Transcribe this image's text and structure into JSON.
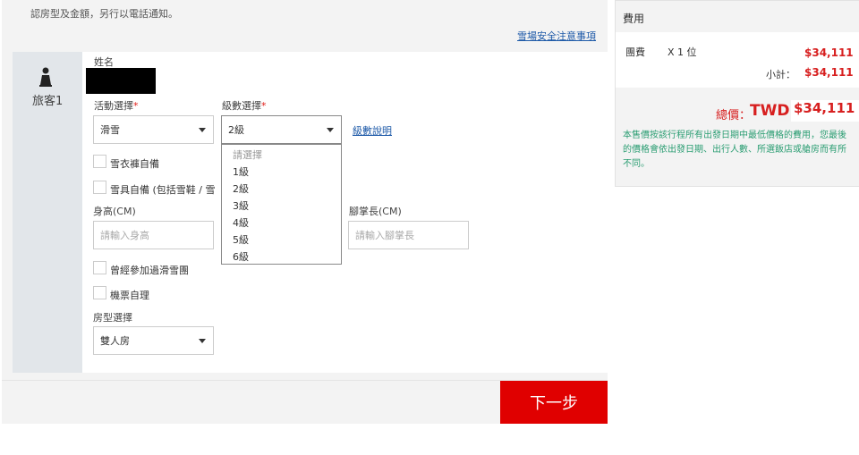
{
  "header": {
    "notice": "認房型及金額，另行以電話通知。",
    "safety_link": "雪場安全注意事項"
  },
  "guest": {
    "label": "旅客1",
    "name_label": "姓名"
  },
  "form": {
    "activity_label": "活動選擇",
    "activity_value": "滑雪",
    "level_label": "級數選擇",
    "level_value": "2級",
    "required_mark": "*",
    "level_help_link": "級數說明",
    "clothes_label": "雪衣褲自備",
    "gear_label": "雪具自備 (包括雪鞋 / 雪",
    "height_label": "身高(CM)",
    "height_placeholder": "請輸入身高",
    "foot_label": "腳掌長(CM)",
    "foot_placeholder": "請輸入腳掌長",
    "joined_label": "曾經參加過滑雪團",
    "flight_label": "機票自理",
    "room_label": "房型選擇",
    "room_value": "雙人房"
  },
  "level_dropdown": {
    "options": [
      "請選擇",
      "1級",
      "2級",
      "3級",
      "4級",
      "5級",
      "6級"
    ]
  },
  "footer": {
    "next_button": "下一步"
  },
  "fees": {
    "header": "費用",
    "item_name": "團費",
    "item_qty": "X 1 位",
    "item_price": "$34,111",
    "subtotal_label": "小計：",
    "subtotal_value": "$34,111",
    "total_label": "總價：",
    "total_currency": "TWD",
    "total_value": "$34,111",
    "note": "本售價按該行程所有出發日期中最低價格的費用，您最後的價格會依出發日期、出行人數、所選飯店或艙房而有所不同。"
  },
  "colors": {
    "accent_red": "#e00000",
    "price_red": "#d71f1f",
    "link_blue": "#1e5aa8",
    "note_green": "#2a9d72"
  }
}
